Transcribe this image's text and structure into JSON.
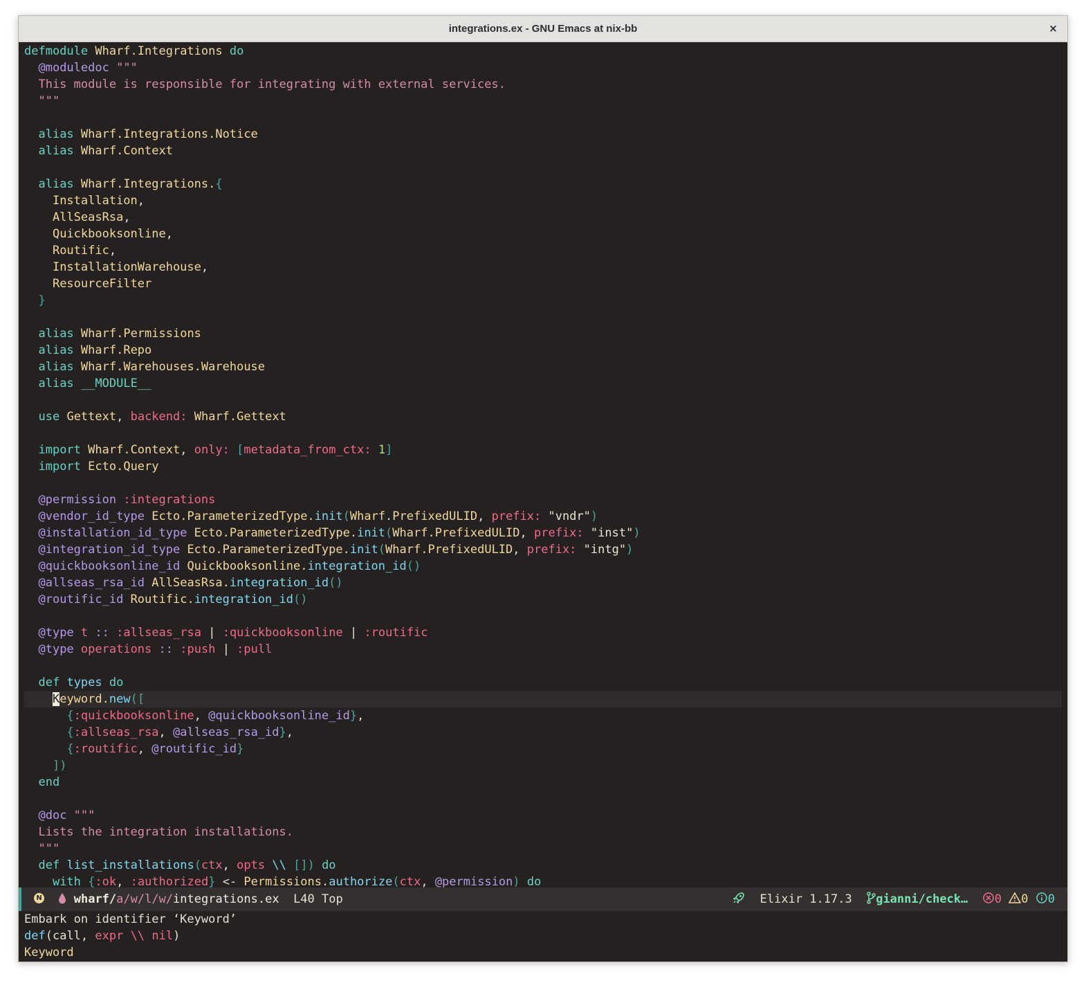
{
  "window": {
    "title": "integrations.ex - GNU Emacs at nix-bb",
    "close": "×"
  },
  "code": [
    [
      [
        "defmodule",
        "k"
      ],
      [
        " ",
        "p"
      ],
      [
        "Wharf.Integrations",
        "m"
      ],
      [
        " ",
        "p"
      ],
      [
        "do",
        "k"
      ]
    ],
    [
      [
        "  ",
        "p"
      ],
      [
        "@moduledoc",
        "at"
      ],
      [
        " \"\"\"",
        "doc"
      ]
    ],
    [
      [
        "  This module is responsible for integrating with external services.",
        "doc"
      ]
    ],
    [
      [
        "  \"\"\"",
        "doc"
      ]
    ],
    [],
    [
      [
        "  ",
        "p"
      ],
      [
        "alias",
        "k"
      ],
      [
        " ",
        "p"
      ],
      [
        "Wharf.Integrations.Notice",
        "m"
      ]
    ],
    [
      [
        "  ",
        "p"
      ],
      [
        "alias",
        "k"
      ],
      [
        " ",
        "p"
      ],
      [
        "Wharf.Context",
        "m"
      ]
    ],
    [],
    [
      [
        "  ",
        "p"
      ],
      [
        "alias",
        "k"
      ],
      [
        " ",
        "p"
      ],
      [
        "Wharf.Integrations.",
        "m"
      ],
      [
        "{",
        "br"
      ]
    ],
    [
      [
        "    ",
        "p"
      ],
      [
        "Installation",
        "m"
      ],
      [
        ",",
        "p"
      ]
    ],
    [
      [
        "    ",
        "p"
      ],
      [
        "AllSeasRsa",
        "m"
      ],
      [
        ",",
        "p"
      ]
    ],
    [
      [
        "    ",
        "p"
      ],
      [
        "Quickbooksonline",
        "m"
      ],
      [
        ",",
        "p"
      ]
    ],
    [
      [
        "    ",
        "p"
      ],
      [
        "Routific",
        "m"
      ],
      [
        ",",
        "p"
      ]
    ],
    [
      [
        "    ",
        "p"
      ],
      [
        "InstallationWarehouse",
        "m"
      ],
      [
        ",",
        "p"
      ]
    ],
    [
      [
        "    ",
        "p"
      ],
      [
        "ResourceFilter",
        "m"
      ]
    ],
    [
      [
        "  ",
        "p"
      ],
      [
        "}",
        "br"
      ]
    ],
    [],
    [
      [
        "  ",
        "p"
      ],
      [
        "alias",
        "k"
      ],
      [
        " ",
        "p"
      ],
      [
        "Wharf.Permissions",
        "m"
      ]
    ],
    [
      [
        "  ",
        "p"
      ],
      [
        "alias",
        "k"
      ],
      [
        " ",
        "p"
      ],
      [
        "Wharf.Repo",
        "m"
      ]
    ],
    [
      [
        "  ",
        "p"
      ],
      [
        "alias",
        "k"
      ],
      [
        " ",
        "p"
      ],
      [
        "Wharf.Warehouses.Warehouse",
        "m"
      ]
    ],
    [
      [
        "  ",
        "p"
      ],
      [
        "alias",
        "k"
      ],
      [
        " ",
        "p"
      ],
      [
        "__MODULE__",
        "k"
      ]
    ],
    [],
    [
      [
        "  ",
        "p"
      ],
      [
        "use",
        "k"
      ],
      [
        " ",
        "p"
      ],
      [
        "Gettext",
        "m"
      ],
      [
        ", ",
        "p"
      ],
      [
        "backend:",
        "sym"
      ],
      [
        " ",
        "p"
      ],
      [
        "Wharf.Gettext",
        "m"
      ]
    ],
    [],
    [
      [
        "  ",
        "p"
      ],
      [
        "import",
        "k"
      ],
      [
        " ",
        "p"
      ],
      [
        "Wharf.Context",
        "m"
      ],
      [
        ", ",
        "p"
      ],
      [
        "only:",
        "sym"
      ],
      [
        " ",
        "p"
      ],
      [
        "[",
        "br"
      ],
      [
        "metadata_from_ctx:",
        "sym"
      ],
      [
        " ",
        "p"
      ],
      [
        "1",
        "num"
      ],
      [
        "]",
        "br"
      ]
    ],
    [
      [
        "  ",
        "p"
      ],
      [
        "import",
        "k"
      ],
      [
        " ",
        "p"
      ],
      [
        "Ecto.Query",
        "m"
      ]
    ],
    [],
    [
      [
        "  ",
        "p"
      ],
      [
        "@permission",
        "at"
      ],
      [
        " ",
        "p"
      ],
      [
        ":integrations",
        "sym"
      ]
    ],
    [
      [
        "  ",
        "p"
      ],
      [
        "@vendor_id_type",
        "at"
      ],
      [
        " ",
        "p"
      ],
      [
        "Ecto.ParameterizedType.",
        "m"
      ],
      [
        "init",
        "fn"
      ],
      [
        "(",
        "br"
      ],
      [
        "Wharf.PrefixedULID",
        "m"
      ],
      [
        ", ",
        "p"
      ],
      [
        "prefix:",
        "sym"
      ],
      [
        " ",
        "p"
      ],
      [
        "\"vndr\"",
        "str"
      ],
      [
        ")",
        "br"
      ]
    ],
    [
      [
        "  ",
        "p"
      ],
      [
        "@installation_id_type",
        "at"
      ],
      [
        " ",
        "p"
      ],
      [
        "Ecto.ParameterizedType.",
        "m"
      ],
      [
        "init",
        "fn"
      ],
      [
        "(",
        "br"
      ],
      [
        "Wharf.PrefixedULID",
        "m"
      ],
      [
        ", ",
        "p"
      ],
      [
        "prefix:",
        "sym"
      ],
      [
        " ",
        "p"
      ],
      [
        "\"inst\"",
        "str"
      ],
      [
        ")",
        "br"
      ]
    ],
    [
      [
        "  ",
        "p"
      ],
      [
        "@integration_id_type",
        "at"
      ],
      [
        " ",
        "p"
      ],
      [
        "Ecto.ParameterizedType.",
        "m"
      ],
      [
        "init",
        "fn"
      ],
      [
        "(",
        "br"
      ],
      [
        "Wharf.PrefixedULID",
        "m"
      ],
      [
        ", ",
        "p"
      ],
      [
        "prefix:",
        "sym"
      ],
      [
        " ",
        "p"
      ],
      [
        "\"intg\"",
        "str"
      ],
      [
        ")",
        "br"
      ]
    ],
    [
      [
        "  ",
        "p"
      ],
      [
        "@quickbooksonline_id",
        "at"
      ],
      [
        " ",
        "p"
      ],
      [
        "Quickbooksonline.",
        "m"
      ],
      [
        "integration_id",
        "fn"
      ],
      [
        "()",
        "br"
      ]
    ],
    [
      [
        "  ",
        "p"
      ],
      [
        "@allseas_rsa_id",
        "at"
      ],
      [
        " ",
        "p"
      ],
      [
        "AllSeasRsa.",
        "m"
      ],
      [
        "integration_id",
        "fn"
      ],
      [
        "()",
        "br"
      ]
    ],
    [
      [
        "  ",
        "p"
      ],
      [
        "@routific_id",
        "at"
      ],
      [
        " ",
        "p"
      ],
      [
        "Routific.",
        "m"
      ],
      [
        "integration_id",
        "fn"
      ],
      [
        "()",
        "br"
      ]
    ],
    [],
    [
      [
        "  ",
        "p"
      ],
      [
        "@type",
        "at"
      ],
      [
        " ",
        "p"
      ],
      [
        "t",
        "ty"
      ],
      [
        " ",
        "p"
      ],
      [
        "::",
        "at"
      ],
      [
        " ",
        "p"
      ],
      [
        ":allseas_rsa",
        "sym"
      ],
      [
        " | ",
        "p"
      ],
      [
        ":quickbooksonline",
        "sym"
      ],
      [
        " | ",
        "p"
      ],
      [
        ":routific",
        "sym"
      ]
    ],
    [
      [
        "  ",
        "p"
      ],
      [
        "@type",
        "at"
      ],
      [
        " ",
        "p"
      ],
      [
        "operations",
        "ty"
      ],
      [
        " ",
        "p"
      ],
      [
        "::",
        "at"
      ],
      [
        " ",
        "p"
      ],
      [
        ":push",
        "sym"
      ],
      [
        " | ",
        "p"
      ],
      [
        ":pull",
        "sym"
      ]
    ],
    [],
    [
      [
        "  ",
        "p"
      ],
      [
        "def",
        "k"
      ],
      [
        " ",
        "p"
      ],
      [
        "types",
        "fn"
      ],
      [
        " ",
        "p"
      ],
      [
        "do",
        "k"
      ]
    ],
    [
      [
        "    ",
        "p"
      ],
      [
        "K",
        "cursor"
      ],
      [
        "eyword.",
        "m"
      ],
      [
        "new",
        "fn"
      ],
      [
        "([",
        "br"
      ]
    ],
    [
      [
        "      ",
        "p"
      ],
      [
        "{",
        "br"
      ],
      [
        ":quickbooksonline",
        "sym"
      ],
      [
        ", ",
        "p"
      ],
      [
        "@quickbooksonline_id",
        "at"
      ],
      [
        "}",
        "br"
      ],
      [
        ",",
        "p"
      ]
    ],
    [
      [
        "      ",
        "p"
      ],
      [
        "{",
        "br"
      ],
      [
        ":allseas_rsa",
        "sym"
      ],
      [
        ", ",
        "p"
      ],
      [
        "@allseas_rsa_id",
        "at"
      ],
      [
        "}",
        "br"
      ],
      [
        ",",
        "p"
      ]
    ],
    [
      [
        "      ",
        "p"
      ],
      [
        "{",
        "br"
      ],
      [
        ":routific",
        "sym"
      ],
      [
        ", ",
        "p"
      ],
      [
        "@routific_id",
        "at"
      ],
      [
        "}",
        "br"
      ]
    ],
    [
      [
        "    ",
        "p"
      ],
      [
        "])",
        "br"
      ]
    ],
    [
      [
        "  ",
        "p"
      ],
      [
        "end",
        "k"
      ]
    ],
    [],
    [
      [
        "  ",
        "p"
      ],
      [
        "@doc",
        "at"
      ],
      [
        " \"\"\"",
        "doc"
      ]
    ],
    [
      [
        "  Lists the integration installations.",
        "doc"
      ]
    ],
    [
      [
        "  \"\"\"",
        "doc"
      ]
    ],
    [
      [
        "  ",
        "p"
      ],
      [
        "def",
        "k"
      ],
      [
        " ",
        "p"
      ],
      [
        "list_installations",
        "fn"
      ],
      [
        "(",
        "br"
      ],
      [
        "ctx",
        "var"
      ],
      [
        ", ",
        "p"
      ],
      [
        "opts",
        "var"
      ],
      [
        " ",
        "p"
      ],
      [
        "\\\\",
        "fn"
      ],
      [
        " ",
        "p"
      ],
      [
        "[]",
        "br"
      ],
      [
        ")",
        "br"
      ],
      [
        " ",
        "p"
      ],
      [
        "do",
        "k"
      ]
    ],
    [
      [
        "    ",
        "p"
      ],
      [
        "with",
        "k"
      ],
      [
        " ",
        "p"
      ],
      [
        "{",
        "br"
      ],
      [
        ":ok",
        "sym"
      ],
      [
        ", ",
        "p"
      ],
      [
        ":authorized",
        "sym"
      ],
      [
        "}",
        "br"
      ],
      [
        " <- ",
        "p"
      ],
      [
        "Permissions.",
        "m"
      ],
      [
        "authorize",
        "fn"
      ],
      [
        "(",
        "br"
      ],
      [
        "ctx",
        "var"
      ],
      [
        ", ",
        "p"
      ],
      [
        "@permission",
        "at"
      ],
      [
        ")",
        "br"
      ],
      [
        " ",
        "p"
      ],
      [
        "do",
        "k"
      ]
    ]
  ],
  "highlight_line": 39,
  "modeline": {
    "state": "N",
    "project": "wharf/",
    "dirs": "a/w/l/w/",
    "file": "integrations.ex",
    "position": "L40 Top",
    "language": "Elixir 1.17.3",
    "branch": "gianni/check…",
    "errors": "0",
    "warnings": "0",
    "infos": "0"
  },
  "minibuffer": [
    [
      [
        "Embark on identifier ‘Keyword’",
        "p"
      ]
    ],
    [
      [
        "def",
        "fn"
      ],
      [
        "(",
        "p"
      ],
      [
        "call",
        "p"
      ],
      [
        ", ",
        "p"
      ],
      [
        "expr",
        "var"
      ],
      [
        " ",
        "p"
      ],
      [
        "\\\\",
        "var"
      ],
      [
        " ",
        "p"
      ],
      [
        "nil",
        "var"
      ],
      [
        ")",
        "p"
      ]
    ],
    [
      [
        "Keyword",
        "m"
      ]
    ]
  ],
  "colors": {
    "background": "#252121",
    "keyword": "#67d3c4",
    "module": "#f1d89c",
    "attribute": "#b39ae8",
    "docstring": "#d58ca8",
    "atom": "#ee6b8a",
    "function": "#7fd7ef",
    "number": "#a8e077",
    "modeline": "#353030"
  },
  "icons": [
    "close-icon",
    "evil-normal-state-icon",
    "file-drop-icon",
    "rocket-icon",
    "git-branch-icon",
    "error-icon",
    "warning-icon",
    "info-icon"
  ]
}
